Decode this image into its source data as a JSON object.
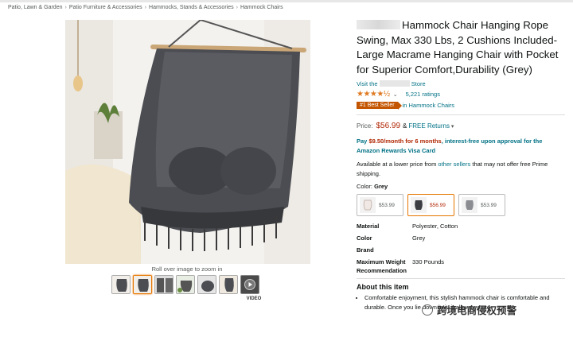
{
  "breadcrumb": [
    "Patio, Lawn & Garden",
    "Patio Furniture & Accessories",
    "Hammocks, Stands & Accessories",
    "Hammock Chairs"
  ],
  "breadcrumb_separator": "›",
  "gallery": {
    "zoom_hint": "Roll over image to zoom in",
    "video_label": "VIDEO",
    "thumbnail_count": 6
  },
  "product": {
    "title": "Hammock Chair Hanging Rope Swing, Max 330 Lbs, 2 Cushions Included-Large Macrame Hanging Chair with Pocket for Superior Comfort,Durability (Grey)",
    "store_prefix": "Visit the",
    "store_suffix": "Store",
    "rating_stars": 4.5,
    "stars_text": "★★★★½",
    "chevron": "⌄",
    "ratings_count": "5,221 ratings",
    "badge": "#1 Best Seller",
    "badge_category": "in Hammock Chairs",
    "price_label": "Price:",
    "price": "$56.99",
    "amp": "&",
    "free_returns": "FREE Returns",
    "finance_pre": "Pay",
    "finance_amount": "$9.50/month for 6 months",
    "finance_post": ", interest-free upon approval for the Amazon Rewards Visa Card",
    "lower_price_pre": "Available at a lower price from",
    "lower_price_link": "other sellers",
    "lower_price_post": "that may not offer free Prime shipping.",
    "color_label": "Color:",
    "color_value": "Grey",
    "swatches": [
      {
        "price": "$53.99",
        "selected": false
      },
      {
        "price": "$56.99",
        "selected": true
      },
      {
        "price": "$53.99",
        "selected": false
      }
    ],
    "specs": [
      {
        "key": "Material",
        "value": "Polyester, Cotton"
      },
      {
        "key": "Color",
        "value": "Grey"
      },
      {
        "key": "Brand",
        "value": ""
      },
      {
        "key": "Maximum Weight Recommendation",
        "value": "330 Pounds"
      }
    ],
    "about_heading": "About this item",
    "bullets": [
      "Comfortable enjoyment, this stylish hammock chair is comfortable and durable. Once you lie down in it, it allows you to"
    ]
  },
  "watermark": "跨境电商侵权预警",
  "colors": {
    "link": "#007185",
    "price": "#b12704",
    "star": "#de7921",
    "badge": "#c45500",
    "selected": "#e77600"
  }
}
